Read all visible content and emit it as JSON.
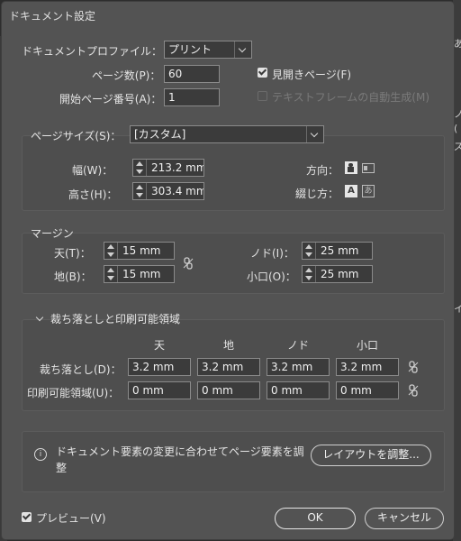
{
  "dialog": {
    "title": "ドキュメント設定",
    "profile_label": "ドキュメントプロファイル：",
    "profile_value": "プリント",
    "pages_label": "ページ数(P)：",
    "pages_value": "60",
    "start_label": "開始ページ番号(A)：",
    "start_value": "1",
    "facing_pages_label": "見開きページ(F)",
    "primary_text_frame_label": "テキストフレームの自動生成(M)"
  },
  "page_size": {
    "label": "ページサイズ(S)：",
    "value": "[カスタム]",
    "width_label": "幅(W)：",
    "width_value": "213.2 mm",
    "height_label": "高さ(H)：",
    "height_value": "303.4 mm",
    "orientation_label": "方向：",
    "binding_label": "綴じ方："
  },
  "margins": {
    "title": "マージン",
    "top_label": "天(T)：",
    "top_value": "15 mm",
    "bottom_label": "地(B)：",
    "bottom_value": "15 mm",
    "inside_label": "ノド(I)：",
    "inside_value": "25 mm",
    "outside_label": "小口(O)：",
    "outside_value": "25 mm"
  },
  "bleed": {
    "title": "裁ち落としと印刷可能領域",
    "columns": [
      "天",
      "地",
      "ノド",
      "小口"
    ],
    "bleed_label": "裁ち落とし(D)：",
    "bleed_values": [
      "3.2 mm",
      "3.2 mm",
      "3.2 mm",
      "3.2 mm"
    ],
    "slug_label": "印刷可能領域(U)：",
    "slug_values": [
      "0 mm",
      "0 mm",
      "0 mm",
      "0 mm"
    ]
  },
  "info": {
    "text": "ドキュメント要素の変更に合わせてページ要素を調整",
    "adjust_button": "レイアウトを調整..."
  },
  "footer": {
    "preview_label": "プレビュー(V)",
    "ok_label": "OK",
    "cancel_label": "キャンセル"
  },
  "background": {
    "right_edge_chars": [
      "あ",
      "ノ",
      "(",
      "ズ",
      "イ"
    ]
  },
  "colors": {
    "dialog_bg": "#535353",
    "field_bg": "#3b3b3b",
    "text": "#e4e4e4"
  }
}
